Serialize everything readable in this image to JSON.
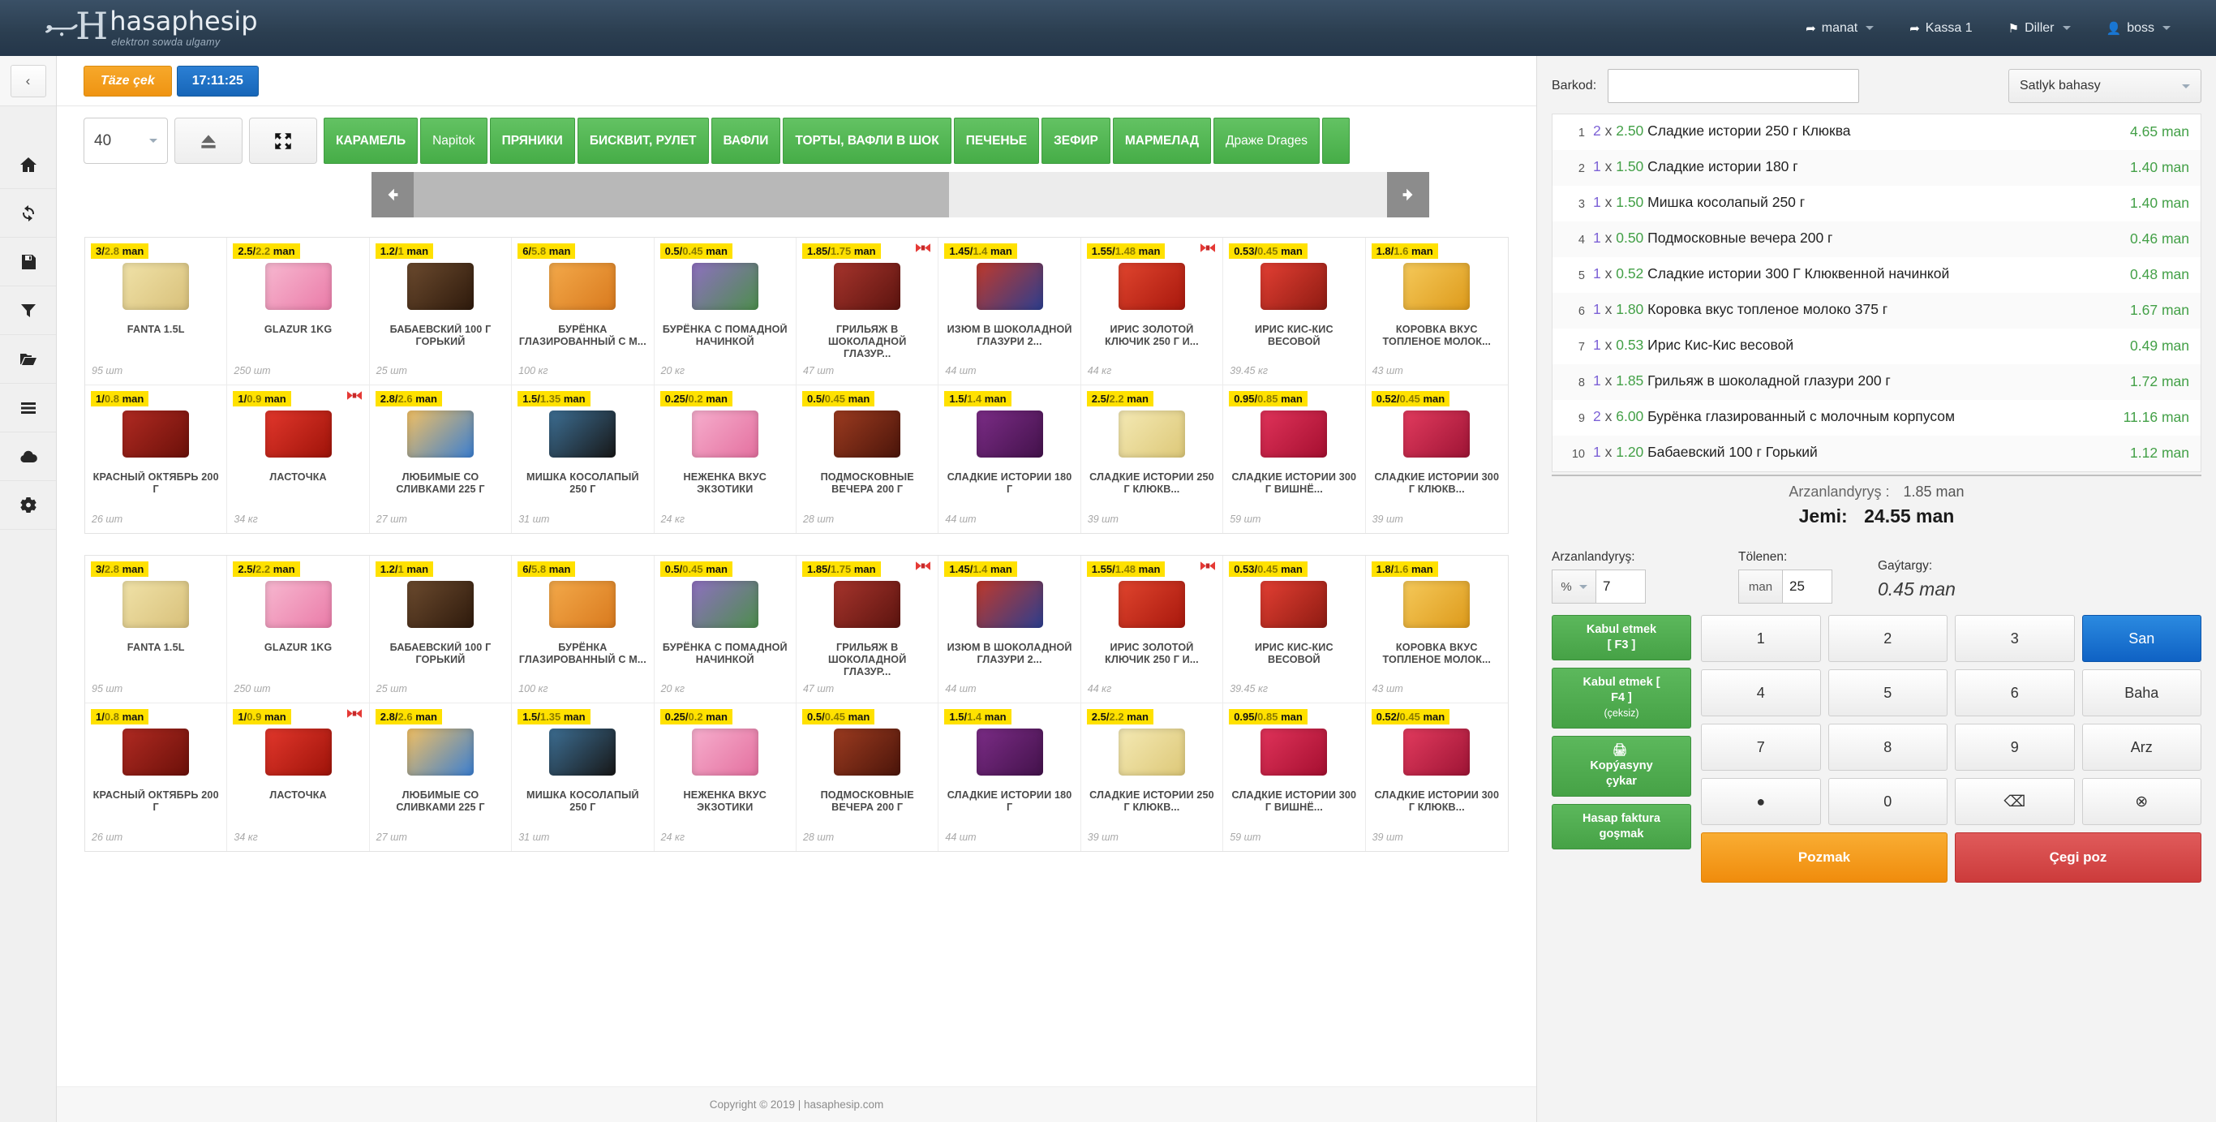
{
  "brand": {
    "name": "hasaphesip",
    "subtitle": "elektron sowda ulgamy",
    "mark": "H"
  },
  "topnav": {
    "items": [
      {
        "label": "manat",
        "icon": "share-icon",
        "caret": true
      },
      {
        "label": "Kassa 1",
        "icon": "share-icon",
        "caret": false
      },
      {
        "label": "Diller",
        "icon": "flag-icon",
        "caret": true
      },
      {
        "label": "boss",
        "icon": "user-icon",
        "caret": true
      }
    ]
  },
  "rail": {
    "collapse_label": "‹",
    "icons": [
      "home-icon",
      "refresh-icon",
      "save-icon",
      "filter-icon",
      "folder-icon",
      "bars-icon",
      "cloud-icon",
      "settings-icon"
    ]
  },
  "toolbar": {
    "fresh_check": "Täze çek",
    "clock": "17:11:25",
    "rows_select": "40",
    "eject_icon": "eject-icon",
    "fullscreen_icon": "expand-icon"
  },
  "categories": [
    "КАРАМЕЛЬ",
    "Napitok",
    "ПРЯНИКИ",
    "БИСКВИТ, РУЛЕТ",
    "ВАФЛИ",
    "ТОРТЫ, ВАФЛИ В ШОК",
    "ПЕЧЕНЬЕ",
    "ЗЕФИР",
    "МАРМЕЛАД",
    "Драже Drages"
  ],
  "products": [
    {
      "price": "3",
      "price_alt": "2.8",
      "unit": "man",
      "name": "FANTA 1.5L",
      "stock": "95 шт",
      "c1": "#f0e2a8",
      "c2": "#d8c07a",
      "bow": false
    },
    {
      "price": "2.5",
      "price_alt": "2.2",
      "unit": "man",
      "name": "GLAZUR 1KG",
      "stock": "250 шт",
      "c1": "#f7b8d0",
      "c2": "#ea7ba8",
      "bow": false
    },
    {
      "price": "1.2",
      "price_alt": "1",
      "unit": "man",
      "name": "БАБАЕВСКИЙ 100 Г ГОРЬКИЙ",
      "stock": "25 шт",
      "c1": "#6b4a2e",
      "c2": "#2e1a0c",
      "bow": false
    },
    {
      "price": "6",
      "price_alt": "5.8",
      "unit": "man",
      "name": "БУРЁНКА ГЛАЗИРОВАННЫЙ С М...",
      "stock": "100 кг",
      "c1": "#f3a94a",
      "c2": "#d97a1e",
      "bow": false
    },
    {
      "price": "0.5",
      "price_alt": "0.45",
      "unit": "man",
      "name": "БУРЁНКА С ПОМАДНОЙ НАЧИНКОЙ",
      "stock": "20 кг",
      "c1": "#8e6fc0",
      "c2": "#4d8e4d",
      "bow": false
    },
    {
      "price": "1.85",
      "price_alt": "1.75",
      "unit": "man",
      "name": "ГРИЛЬЯЖ В ШОКОЛАДНОЙ ГЛАЗУР...",
      "stock": "47 шт",
      "c1": "#a6342c",
      "c2": "#5c140f",
      "bow": true
    },
    {
      "price": "1.45",
      "price_alt": "1.4",
      "unit": "man",
      "name": "ИЗЮМ В ШОКОЛАДНОЙ ГЛАЗУРИ 2...",
      "stock": "44 шт",
      "c1": "#c0392b",
      "c2": "#2c3e8f",
      "bow": false
    },
    {
      "price": "1.55",
      "price_alt": "1.48",
      "unit": "man",
      "name": "ИРИС ЗОЛОТОЙ КЛЮЧИК 250 Г И...",
      "stock": "44 кг",
      "c1": "#e0452e",
      "c2": "#a8180d",
      "bow": true
    },
    {
      "price": "0.53",
      "price_alt": "0.45",
      "unit": "man",
      "name": "ИРИС КИС-КИС ВЕСОВОЙ",
      "stock": "39.45 кг",
      "c1": "#e33f33",
      "c2": "#8e1b12",
      "bow": false
    },
    {
      "price": "1.8",
      "price_alt": "1.6",
      "unit": "man",
      "name": "КОРОВКА ВКУС ТОПЛЕНОЕ МОЛОК...",
      "stock": "43 шт",
      "c1": "#f5c95a",
      "c2": "#dd9a1b",
      "bow": false
    },
    {
      "price": "1",
      "price_alt": "0.8",
      "unit": "man",
      "name": "КРАСНЫЙ ОКТЯБРЬ 200 Г",
      "stock": "26 шт",
      "c1": "#b02a22",
      "c2": "#6b1009",
      "bow": false
    },
    {
      "price": "1",
      "price_alt": "0.9",
      "unit": "man",
      "name": "ЛАСТОЧКА",
      "stock": "34 кг",
      "c1": "#e2372c",
      "c2": "#9e1309",
      "bow": true
    },
    {
      "price": "2.8",
      "price_alt": "2.6",
      "unit": "man",
      "name": "ЛЮБИМЫЕ СО СЛИВКАМИ 225 Г",
      "stock": "27 шт",
      "c1": "#f2c063",
      "c2": "#3b7fd1",
      "bow": false
    },
    {
      "price": "1.5",
      "price_alt": "1.35",
      "unit": "man",
      "name": "МИШКА КОСОЛАПЫЙ 250 Г",
      "stock": "31 шт",
      "c1": "#3d6f94",
      "c2": "#171717",
      "bow": false
    },
    {
      "price": "0.25",
      "price_alt": "0.2",
      "unit": "man",
      "name": "НЕЖЕНКА ВКУС ЭКЗОТИКИ",
      "stock": "24 кг",
      "c1": "#f6aecd",
      "c2": "#e4709f",
      "bow": false
    },
    {
      "price": "0.5",
      "price_alt": "0.45",
      "unit": "man",
      "name": "ПОДМОСКОВНЫЕ ВЕЧЕРА 200 Г",
      "stock": "28 шт",
      "c1": "#9c3b20",
      "c2": "#4b150a",
      "bow": false
    },
    {
      "price": "1.5",
      "price_alt": "1.4",
      "unit": "man",
      "name": "СЛАДКИЕ ИСТОРИИ 180 Г",
      "stock": "44 шт",
      "c1": "#7b2c86",
      "c2": "#43124b",
      "bow": false
    },
    {
      "price": "2.5",
      "price_alt": "2.2",
      "unit": "man",
      "name": "СЛАДКИЕ ИСТОРИИ 250 Г КЛЮКВ...",
      "stock": "39 шт",
      "c1": "#f4e9b4",
      "c2": "#ddc878",
      "bow": false
    },
    {
      "price": "0.95",
      "price_alt": "0.85",
      "unit": "man",
      "name": "СЛАДКИЕ ИСТОРИИ 300 Г ВИШНЁ...",
      "stock": "59 шт",
      "c1": "#e0335a",
      "c2": "#a50f30",
      "bow": false
    },
    {
      "price": "0.52",
      "price_alt": "0.45",
      "unit": "man",
      "name": "СЛАДКИЕ ИСТОРИИ 300 Г КЛЮКВ...",
      "stock": "39 шт",
      "c1": "#e23b5e",
      "c2": "#9e1435",
      "bow": false
    }
  ],
  "footer": {
    "copyright": "Copyright © 2019 | hasaphesip.com"
  },
  "right": {
    "barkod_label": "Barkod:",
    "barkod_value": "",
    "barkod_placeholder": "",
    "price_type": "Satlyk bahasy",
    "receipt": [
      {
        "idx": "1",
        "qty": "2",
        "unit_price": "2.50",
        "name": "Сладкие истории 250 г Клюква",
        "total": "4.65 man"
      },
      {
        "idx": "2",
        "qty": "1",
        "unit_price": "1.50",
        "name": "Сладкие истории 180 г",
        "total": "1.40 man"
      },
      {
        "idx": "3",
        "qty": "1",
        "unit_price": "1.50",
        "name": "Мишка косолапый 250 г",
        "total": "1.40 man"
      },
      {
        "idx": "4",
        "qty": "1",
        "unit_price": "0.50",
        "name": "Подмосковные вечера 200 г",
        "total": "0.46 man"
      },
      {
        "idx": "5",
        "qty": "1",
        "unit_price": "0.52",
        "name": "Сладкие истории 300 Г Клюквенной начинкой",
        "total": "0.48 man"
      },
      {
        "idx": "6",
        "qty": "1",
        "unit_price": "1.80",
        "name": "Коровка вкус топленое молоко 375 г",
        "total": "1.67 man"
      },
      {
        "idx": "7",
        "qty": "1",
        "unit_price": "0.53",
        "name": "Ирис Кис-Кис весовой",
        "total": "0.49 man"
      },
      {
        "idx": "8",
        "qty": "1",
        "unit_price": "1.85",
        "name": "Грильяж в шоколадной глазури 200 г",
        "total": "1.72 man"
      },
      {
        "idx": "9",
        "qty": "2",
        "unit_price": "6.00",
        "name": "Бурёнка глазированный с молочным корпусом",
        "total": "11.16 man"
      },
      {
        "idx": "10",
        "qty": "1",
        "unit_price": "1.20",
        "name": "Бабаевский 100 г Горький",
        "total": "1.12 man"
      }
    ],
    "multiplier": "x",
    "discount_total_label": "Arzanlandyryş :",
    "discount_total_value": "1.85 man",
    "grand_label": "Jemi:",
    "grand_value": "24.55 man",
    "discount_label": "Arzanlandyryş:",
    "discount_mode": "%",
    "discount_value": "7",
    "paid_label": "Tölenen:",
    "paid_prefix": "man",
    "paid_value": "25",
    "change_label": "Gaýtargy:",
    "change_value": "0.45 man",
    "actions": [
      {
        "line1": "Kabul etmek",
        "line2": "[ F3 ]",
        "line3": "",
        "icon": ""
      },
      {
        "line1": "Kabul etmek [",
        "line2": "F4 ]",
        "line3": "(çeksiz)",
        "icon": ""
      },
      {
        "line1": "Kopýasyny",
        "line2": "çykar",
        "line3": "",
        "icon": "printer-icon"
      },
      {
        "line1": "Hasap faktura",
        "line2": "goşmak",
        "line3": "",
        "icon": ""
      }
    ],
    "keypad": [
      {
        "label": "1",
        "kind": "num"
      },
      {
        "label": "2",
        "kind": "num"
      },
      {
        "label": "3",
        "kind": "num"
      },
      {
        "label": "San",
        "kind": "blue"
      },
      {
        "label": "4",
        "kind": "num"
      },
      {
        "label": "5",
        "kind": "num"
      },
      {
        "label": "6",
        "kind": "num"
      },
      {
        "label": "Baha",
        "kind": "fn"
      },
      {
        "label": "7",
        "kind": "num"
      },
      {
        "label": "8",
        "kind": "num"
      },
      {
        "label": "9",
        "kind": "num"
      },
      {
        "label": "Arz",
        "kind": "fn"
      },
      {
        "label": "●",
        "kind": "num"
      },
      {
        "label": "0",
        "kind": "num"
      },
      {
        "label": "⌫",
        "kind": "ico"
      },
      {
        "label": "⊗",
        "kind": "ico"
      }
    ],
    "cancel_label": "Pozmak",
    "void_label": "Çegi poz"
  },
  "colors": {
    "green": "#4fae4f",
    "orange": "#f0921a",
    "blue": "#1766b8",
    "red": "#d14343",
    "badge": "#ffe100"
  }
}
